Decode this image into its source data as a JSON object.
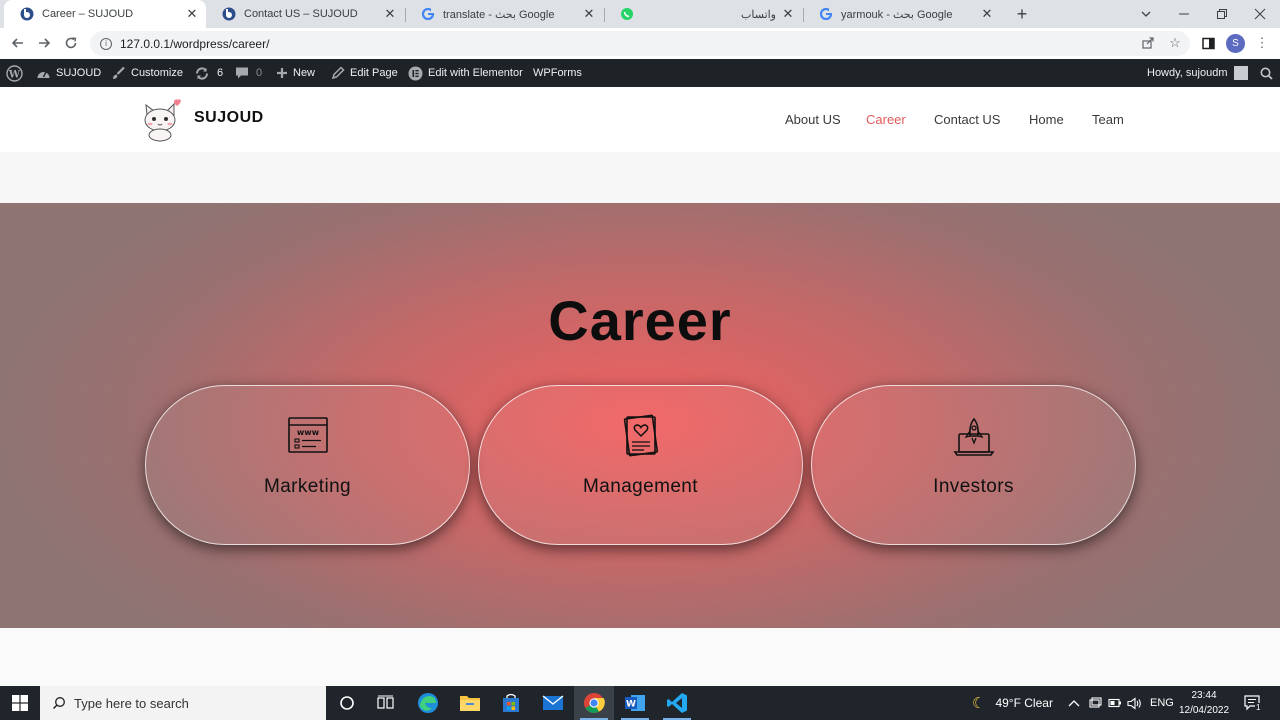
{
  "browser": {
    "tabs": [
      {
        "label": "Career – SUJOUD",
        "icon": "wordpress-site-icon",
        "active": true
      },
      {
        "label": "Contact US – SUJOUD",
        "icon": "wordpress-site-icon",
        "active": false
      },
      {
        "label": "translate - بحث Google",
        "icon": "google-icon",
        "active": false
      },
      {
        "label": "واتساب",
        "icon": "whatsapp-icon",
        "active": false
      },
      {
        "label": "yarmouk - بحث Google",
        "icon": "google-icon",
        "active": false
      }
    ],
    "address": "127.0.0.1/wordpress/career/",
    "profile_initial": "S"
  },
  "adminbar": {
    "site_name": "SUJOUD",
    "customize": "Customize",
    "updates_count": "6",
    "comments_count": "0",
    "new_label": "New",
    "edit_page": "Edit Page",
    "elementor": "Edit with Elementor",
    "wpforms": "WPForms",
    "howdy": "Howdy, sujoudm"
  },
  "site": {
    "title": "SUJOUD",
    "nav": [
      "About US",
      "Career",
      "Contact US",
      "Home",
      "Team"
    ],
    "current_nav": "Career"
  },
  "hero": {
    "title": "Career",
    "cards": [
      {
        "label": "Marketing",
        "icon": "web-browser-icon"
      },
      {
        "label": "Management",
        "icon": "heart-document-icon"
      },
      {
        "label": "Investors",
        "icon": "rocket-laptop-icon"
      }
    ]
  },
  "taskbar": {
    "search_placeholder": "Type here to search",
    "weather": "49°F  Clear",
    "language": "ENG",
    "time": "23:44",
    "date": "12/04/2022",
    "notifications": "1"
  }
}
